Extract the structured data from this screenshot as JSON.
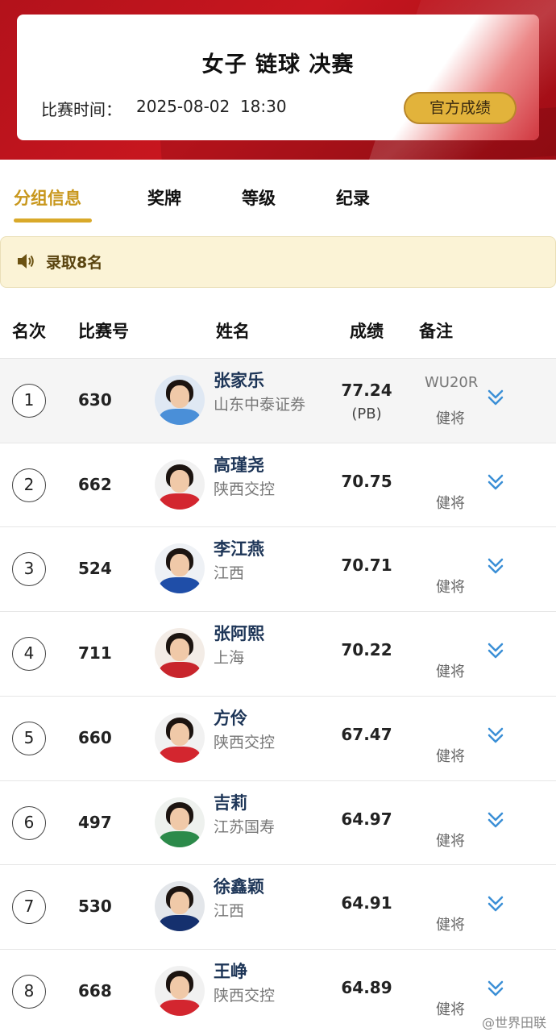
{
  "event": {
    "title": "女子 链球 决赛",
    "time_label": "比赛时间：",
    "time_value": "2025-08-02  18:30",
    "official_button": "官方成绩"
  },
  "tabs": [
    {
      "label": "分组信息",
      "active": true
    },
    {
      "label": "奖牌",
      "active": false
    },
    {
      "label": "等级",
      "active": false
    },
    {
      "label": "纪录",
      "active": false
    }
  ],
  "notice": {
    "icon": "speaker-icon",
    "text": "录取8名"
  },
  "table": {
    "headers": {
      "rank": "名次",
      "bib": "比赛号",
      "name": "姓名",
      "result": "成绩",
      "note": "备注"
    },
    "rows": [
      {
        "rank": "1",
        "bib": "630",
        "name": "张家乐",
        "team": "山东中泰证券",
        "result": "77.24",
        "pb": "(PB)",
        "note_code": "WU20R",
        "note": "健将",
        "shirt": "#4a8fd8",
        "bg": "#dfe8f3"
      },
      {
        "rank": "2",
        "bib": "662",
        "name": "高瑾尧",
        "team": "陕西交控",
        "result": "70.75",
        "pb": "",
        "note_code": "",
        "note": "健将",
        "shirt": "#d3262f",
        "bg": "#f1f1f1"
      },
      {
        "rank": "3",
        "bib": "524",
        "name": "李江燕",
        "team": "江西",
        "result": "70.71",
        "pb": "",
        "note_code": "",
        "note": "健将",
        "shirt": "#1f4ea8",
        "bg": "#eef1f5"
      },
      {
        "rank": "4",
        "bib": "711",
        "name": "张阿熙",
        "team": "上海",
        "result": "70.22",
        "pb": "",
        "note_code": "",
        "note": "健将",
        "shirt": "#c8252c",
        "bg": "#f3ece6"
      },
      {
        "rank": "5",
        "bib": "660",
        "name": "方伶",
        "team": "陕西交控",
        "result": "67.47",
        "pb": "",
        "note_code": "",
        "note": "健将",
        "shirt": "#d3262f",
        "bg": "#f1f1f1"
      },
      {
        "rank": "6",
        "bib": "497",
        "name": "吉莉",
        "team": "江苏国寿",
        "result": "64.97",
        "pb": "",
        "note_code": "",
        "note": "健将",
        "shirt": "#2c8a4a",
        "bg": "#eef1ee"
      },
      {
        "rank": "7",
        "bib": "530",
        "name": "徐鑫颖",
        "team": "江西",
        "result": "64.91",
        "pb": "",
        "note_code": "",
        "note": "健将",
        "shirt": "#15306e",
        "bg": "#e3e6ea"
      },
      {
        "rank": "8",
        "bib": "668",
        "name": "王峥",
        "team": "陕西交控",
        "result": "64.89",
        "pb": "",
        "note_code": "",
        "note": "健将",
        "shirt": "#d3262f",
        "bg": "#f1f1f1"
      }
    ]
  },
  "watermark": "@世界田联",
  "colors": {
    "header_red": "#c8161f",
    "accent_gold": "#d9a92a",
    "notice_bg": "#fbf3d6",
    "name_blue": "#1d3557",
    "expand_blue": "#3b8fd6"
  }
}
